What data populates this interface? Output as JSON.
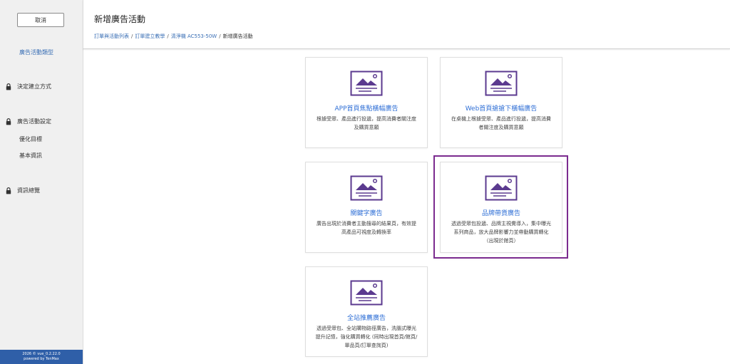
{
  "sidebar": {
    "cancel_label": "取消",
    "active_item": "廣告活動類型",
    "sections": [
      {
        "label": "決定建立方式"
      },
      {
        "label": "廣告活動設定",
        "subitems": [
          "優化目標",
          "基本資訊"
        ]
      },
      {
        "label": "資訊總覽"
      }
    ],
    "footer_line1": "2026 © vue_0.2.22.0",
    "footer_line2": "powered by TenMax"
  },
  "header": {
    "title": "新增廣告活動",
    "breadcrumb": {
      "items": [
        "訂單與活動列表",
        "訂單建立教學",
        "清淨機 AC553-50W"
      ],
      "current": "新增廣告活動",
      "separator": "/"
    }
  },
  "cards": [
    {
      "title": "APP首頁焦點橫幅廣告",
      "desc": "根據受眾、產品進行投遞，提高消費者關注度及購買意願"
    },
    {
      "title": "Web首頁搶搶下橫幅廣告",
      "desc": "在桌機上根據受眾、產品進行投遞，提高消費者關注度及購買意願"
    },
    {
      "title": "關鍵字廣告",
      "desc": "廣告出現於消費者主動搜尋的結果頁，有效提高產品可視度及轉換率"
    },
    {
      "title": "品牌帶貨廣告",
      "desc": "透過受眾包投遞、品牌主視覺導入，集中曝光系列商品，放大品牌影響力並帶動購買轉化（出現於館頁）"
    },
    {
      "title": "全站推薦廣告",
      "desc": "透過受眾包、全站購物路徑廣告，洗腦式曝光提升記憶，強化購買轉化 (同時出現首頁/館頁/單品頁/訂單查詢頁)"
    }
  ],
  "colors": {
    "accent": "#3a6fb5",
    "card_title": "#2f6fd6",
    "icon": "#5b3a8f",
    "selected_border": "#7b2b8f",
    "footer": "#2f5fa8"
  },
  "selected_card_index": 3
}
